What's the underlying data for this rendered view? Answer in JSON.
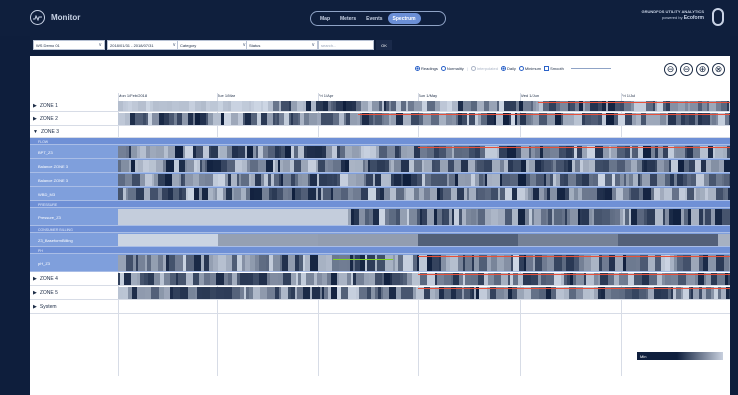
{
  "app": {
    "title": "Monitor"
  },
  "nav": {
    "tabs": [
      "Map",
      "Meters",
      "Events",
      "Spectrum"
    ],
    "active": "Spectrum"
  },
  "brand": {
    "line1": "GRUNDFOS UTILITY ANALYTICS",
    "line2_prefix": "powered by",
    "line2_name": "Ecoform"
  },
  "filters": {
    "dataset": "WS Demo 01",
    "date_range": "2018/01/31 - 2018/07/31",
    "category": "Category",
    "status": "Status",
    "search_placeholder": "search...",
    "ok_label": "OK"
  },
  "options": {
    "readings": "Readings",
    "normality": "Normality",
    "interpolated": "Interpolated",
    "daily": "Daily",
    "minimum": "Minimum",
    "smooth": "Smooth"
  },
  "zoom": {
    "out": "⊖",
    "fit": "⊖",
    "in": "⊕",
    "reset": "⊗"
  },
  "axis": {
    "ticks": [
      "Mon 1/Feb/2018",
      "Tue 1/Mar",
      "Fri 1/Apr",
      "Sun 1/May",
      "Wed 1/Jun",
      "Fri 1/Jul"
    ]
  },
  "rows": [
    {
      "label": "ZONE 1",
      "kind": "zone",
      "expanded": false
    },
    {
      "label": "ZONE 2",
      "kind": "zone",
      "expanded": false
    },
    {
      "label": "ZONE 3",
      "kind": "zone",
      "expanded": true
    },
    {
      "label": "FLOW",
      "kind": "group"
    },
    {
      "label": "BPT_Z3",
      "kind": "sub"
    },
    {
      "label": "Balance ZONE 3",
      "kind": "sub"
    },
    {
      "label": "Balance ZONE 3",
      "kind": "sub"
    },
    {
      "label": "WBD_M3",
      "kind": "sub"
    },
    {
      "label": "PRESSURE",
      "kind": "group"
    },
    {
      "label": "Pressure_Z3",
      "kind": "sub"
    },
    {
      "label": "CONSUMER BILLING",
      "kind": "group"
    },
    {
      "label": "Z3_BaseformBilling",
      "kind": "sub"
    },
    {
      "label": "PH",
      "kind": "group"
    },
    {
      "label": "pH_Z3",
      "kind": "sub"
    },
    {
      "label": "ZONE 4",
      "kind": "zone",
      "expanded": false
    },
    {
      "label": "ZONE 5",
      "kind": "zone",
      "expanded": false
    },
    {
      "label": "System",
      "kind": "zone",
      "expanded": false
    }
  ],
  "legend": {
    "min_label": "Min"
  },
  "colors": {
    "nav_bg": "#0f1f3d",
    "accent": "#6b8fd6",
    "alert": "#e8503a",
    "highlight": "#7ed321"
  }
}
